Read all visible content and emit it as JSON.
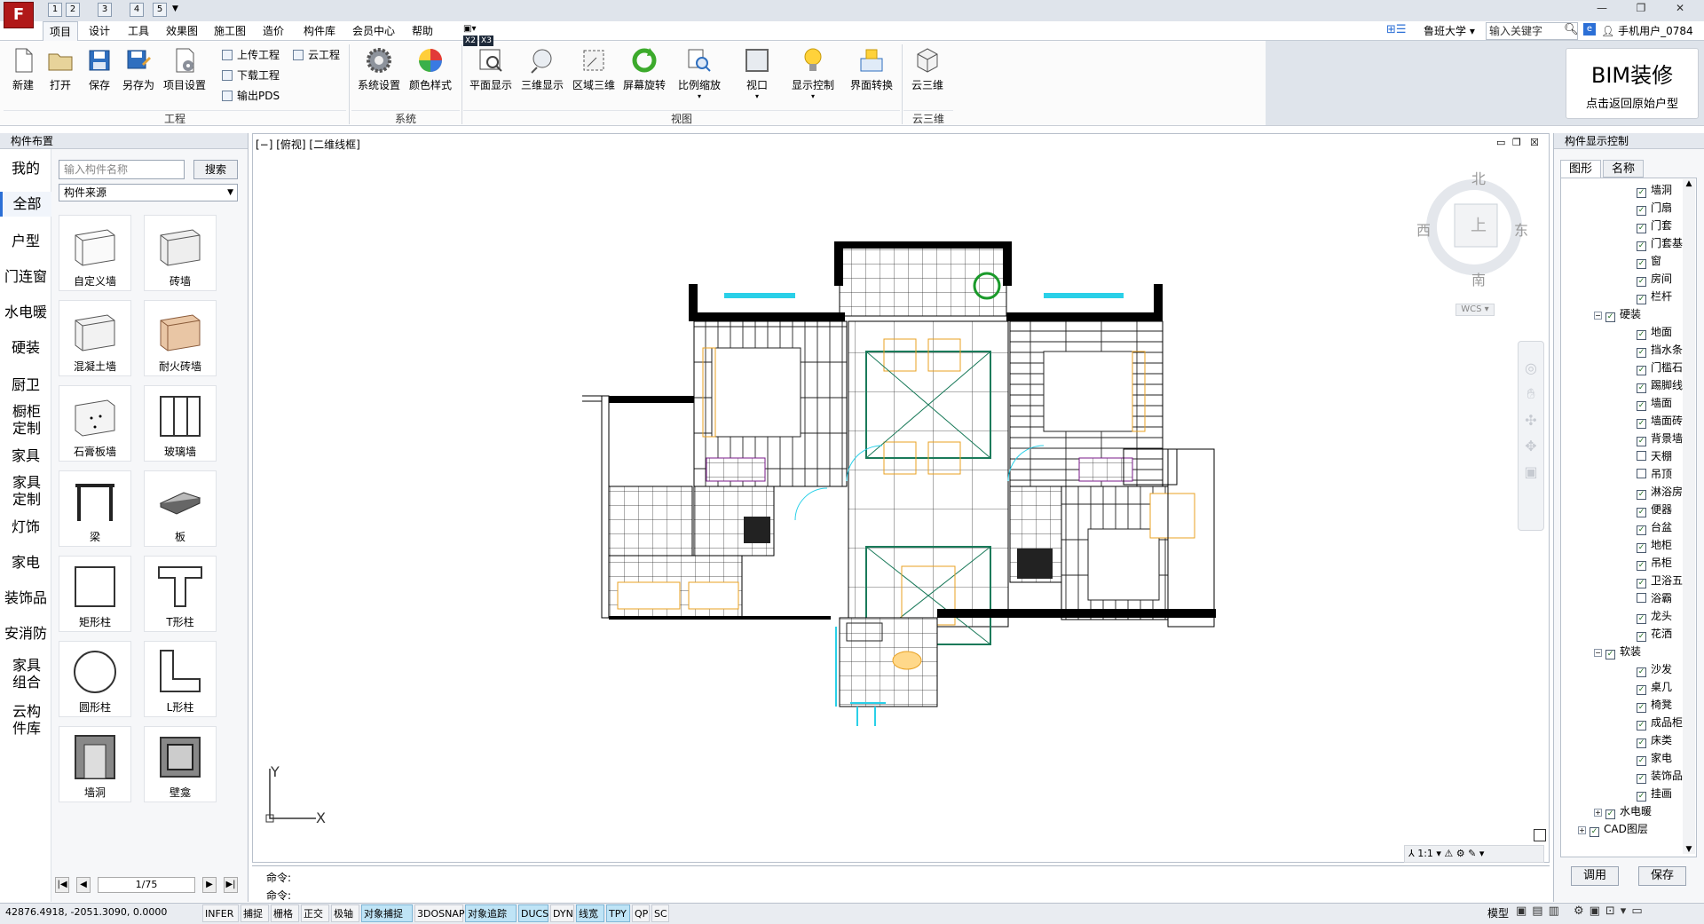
{
  "menu": {
    "items": [
      "项目",
      "设计",
      "工具",
      "效果图",
      "施工图",
      "造价",
      "构件库",
      "会员中心",
      "帮助"
    ],
    "active": "项目",
    "quick_access": [
      "1",
      "2",
      "3",
      "4",
      "5"
    ],
    "right": {
      "university": "鲁班大学",
      "search_placeholder": "输入关键字",
      "user": "手机用户_0784"
    }
  },
  "ribbon": {
    "project_buttons": [
      "新建",
      "打开",
      "保存",
      "另存为",
      "项目设置"
    ],
    "small_buttons": [
      "上传工程",
      "云工程",
      "下载工程",
      "输出PDS"
    ],
    "system_buttons": [
      "系统设置",
      "颜色样式"
    ],
    "view_buttons": [
      "平面显示",
      "三维显示",
      "区域三维",
      "屏幕旋转",
      "比例缩放",
      "视口",
      "显示控制",
      "界面转换"
    ],
    "cloud_buttons": [
      "云三维"
    ],
    "groups": [
      "工程",
      "系统",
      "视图",
      "云三维"
    ],
    "badges": [
      "X2",
      "X3"
    ]
  },
  "promo": {
    "title": "BIM装修",
    "subtitle": "点击返回原始户型"
  },
  "left_panel": {
    "title": "构件布置",
    "categories": [
      "我的",
      "全部",
      "户型",
      "门连窗",
      "水电暖",
      "硬装",
      "厨卫",
      "橱柜定制",
      "家具",
      "家具定制",
      "灯饰",
      "家电",
      "装饰品",
      "安消防",
      "家具组合",
      "云构件库"
    ],
    "active_category": "全部",
    "search_placeholder": "输入构件名称",
    "search_button": "搜索",
    "source_label": "构件来源",
    "components": [
      "自定义墙",
      "砖墙",
      "混凝土墙",
      "耐火砖墙",
      "石膏板墙",
      "玻璃墙",
      "梁",
      "板",
      "矩形柱",
      "T形柱",
      "圆形柱",
      "L形柱",
      "墙洞",
      "壁龛"
    ],
    "pager": "1/75"
  },
  "drawing": {
    "view_label": "[−] [俯视] [二维线框]",
    "compass": {
      "north": "北",
      "south": "南",
      "east": "东",
      "west": "西",
      "center": "上"
    },
    "wcs": "WCS",
    "axis_x": "X",
    "axis_y": "Y",
    "scale": "1:1"
  },
  "command": {
    "line1": "命令:",
    "line2": "命令:"
  },
  "status": {
    "coords": "42876.4918, -2051.3090, 0.0000",
    "toggles": [
      {
        "label": "INFER",
        "on": false
      },
      {
        "label": "捕捉",
        "on": false
      },
      {
        "label": "栅格",
        "on": false
      },
      {
        "label": "正交",
        "on": false
      },
      {
        "label": "极轴",
        "on": false
      },
      {
        "label": "对象捕捉",
        "on": true
      },
      {
        "label": "3DOSNAP",
        "on": false
      },
      {
        "label": "对象追踪",
        "on": true
      },
      {
        "label": "DUCS",
        "on": true
      },
      {
        "label": "DYN",
        "on": false
      },
      {
        "label": "线宽",
        "on": true
      },
      {
        "label": "TPY",
        "on": true
      },
      {
        "label": "QP",
        "on": false
      },
      {
        "label": "SC",
        "on": false
      }
    ],
    "model": "模型"
  },
  "right_panel": {
    "title": "构件显示控制",
    "tabs": [
      "图形",
      "名称"
    ],
    "tree": [
      {
        "label": "墙洞",
        "level": 2,
        "checked": true
      },
      {
        "label": "门扇",
        "level": 2,
        "checked": true
      },
      {
        "label": "门套",
        "level": 2,
        "checked": true
      },
      {
        "label": "门套基",
        "level": 2,
        "checked": true
      },
      {
        "label": "窗",
        "level": 2,
        "checked": true
      },
      {
        "label": "房间",
        "level": 2,
        "checked": true
      },
      {
        "label": "栏杆",
        "level": 2,
        "checked": true
      },
      {
        "label": "硬装",
        "level": 1,
        "checked": true,
        "expander": "−"
      },
      {
        "label": "地面",
        "level": 2,
        "checked": true
      },
      {
        "label": "挡水条",
        "level": 2,
        "checked": true
      },
      {
        "label": "门槛石",
        "level": 2,
        "checked": true
      },
      {
        "label": "踢脚线",
        "level": 2,
        "checked": true
      },
      {
        "label": "墙面",
        "level": 2,
        "checked": true
      },
      {
        "label": "墙面砖",
        "level": 2,
        "checked": true
      },
      {
        "label": "背景墙",
        "level": 2,
        "checked": true
      },
      {
        "label": "天棚",
        "level": 2,
        "checked": false
      },
      {
        "label": "吊顶",
        "level": 2,
        "checked": false
      },
      {
        "label": "淋浴房",
        "level": 2,
        "checked": true
      },
      {
        "label": "便器",
        "level": 2,
        "checked": true
      },
      {
        "label": "台盆",
        "level": 2,
        "checked": true
      },
      {
        "label": "地柜",
        "level": 2,
        "checked": true
      },
      {
        "label": "吊柜",
        "level": 2,
        "checked": true
      },
      {
        "label": "卫浴五",
        "level": 2,
        "checked": true
      },
      {
        "label": "浴霸",
        "level": 2,
        "checked": false
      },
      {
        "label": "龙头",
        "level": 2,
        "checked": true
      },
      {
        "label": "花洒",
        "level": 2,
        "checked": true
      },
      {
        "label": "软装",
        "level": 1,
        "checked": true,
        "expander": "−"
      },
      {
        "label": "沙发",
        "level": 2,
        "checked": true
      },
      {
        "label": "桌几",
        "level": 2,
        "checked": true
      },
      {
        "label": "椅凳",
        "level": 2,
        "checked": true
      },
      {
        "label": "成品柜",
        "level": 2,
        "checked": true
      },
      {
        "label": "床类",
        "level": 2,
        "checked": true
      },
      {
        "label": "家电",
        "level": 2,
        "checked": true
      },
      {
        "label": "装饰品",
        "level": 2,
        "checked": true
      },
      {
        "label": "挂画",
        "level": 2,
        "checked": true
      },
      {
        "label": "水电暖",
        "level": 1,
        "checked": true,
        "expander": "+"
      },
      {
        "label": "CAD图层",
        "level": 0,
        "checked": true,
        "expander": "+"
      }
    ],
    "buttons": [
      "调用",
      "保存"
    ]
  }
}
